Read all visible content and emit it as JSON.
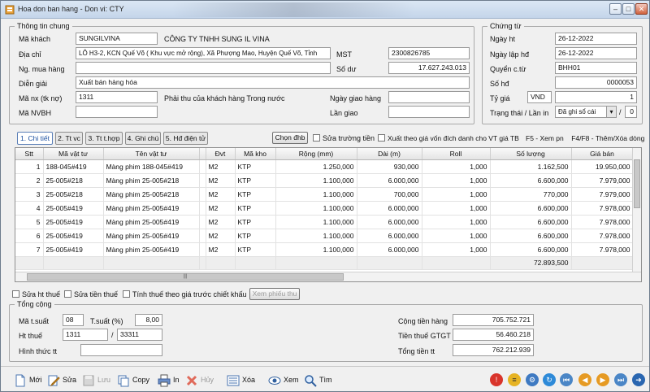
{
  "window": {
    "title": "Hoa don ban hang - Don vi: CTY"
  },
  "general": {
    "legend": "Thông tin chung",
    "customer_code_label": "Mã khách",
    "customer_code": "SUNGILVINA",
    "customer_name": "CÔNG TY TNHH SUNG IL VINA",
    "address_label": "Địa chỉ",
    "address": "LÔ H3-2, KCN Quế Võ ( Khu vực mở rộng), Xã Phượng Mao, Huyện Quế Võ, Tỉnh",
    "tax_code_label": "MST",
    "tax_code": "2300826785",
    "buyer_label": "Ng. mua hàng",
    "buyer": "",
    "balance_label": "Số dư",
    "balance": "17.627.243.013",
    "description_label": "Diễn giải",
    "description": "Xuất bán hàng hóa",
    "account_label": "Mã nx (tk nợ)",
    "account": "1311",
    "account_desc": "Phải thu của khách hàng Trong nước",
    "delivery_date_label": "Ngày giao hàng",
    "delivery_date": "",
    "staff_label": "Mã NVBH",
    "staff": "",
    "delivery_times_label": "Lần giao",
    "delivery_times": ""
  },
  "voucher": {
    "legend": "Chứng từ",
    "date_label": "Ngày ht",
    "date": "26-12-2022",
    "invoice_date_label": "Ngày lập hđ",
    "invoice_date": "26-12-2022",
    "book_label": "Quyển c.từ",
    "book": "BHH01",
    "invoice_no_label": "Số hđ",
    "invoice_no": "0000053",
    "rate_label": "Tỷ giá",
    "currency": "VND",
    "rate": "1",
    "status_label": "Trạng thái / Lần in",
    "status": "Đã ghi sổ cái",
    "print_count": "0"
  },
  "tabs": [
    "1. Chi tiết",
    "2. Tt vc",
    "3. Tt t.hợp",
    "4. Ghi chú",
    "5. Hđ điện tử"
  ],
  "detail_bar": {
    "choose_button": "Chọn đhb",
    "edit_amount_label": "Sửa trường tiền",
    "export_label": "Xuất theo giá vốn đích danh cho VT giá TB",
    "hint": "F5 - Xem pn    F4/F8 - Thêm/Xóa dòng"
  },
  "grid": {
    "columns": [
      "Stt",
      "Mã vật tư",
      "Tên vật tư",
      "",
      "Đvt",
      "Mã kho",
      "Rộng (mm)",
      "Dài (m)",
      "Roll",
      "Số lượng",
      "Giá bán"
    ],
    "rows": [
      [
        "1",
        "188-045#419",
        "Màng phim 188-045#419",
        "",
        "M2",
        "KTP",
        "1.250,000",
        "930,000",
        "1,000",
        "1.162,500",
        "19.950,000"
      ],
      [
        "2",
        "25-005#218",
        "Màng phim 25-005#218",
        "",
        "M2",
        "KTP",
        "1.100,000",
        "6.000,000",
        "1,000",
        "6.600,000",
        "7.979,000"
      ],
      [
        "3",
        "25-005#218",
        "Màng phim 25-005#218",
        "",
        "M2",
        "KTP",
        "1.100,000",
        "700,000",
        "1,000",
        "770,000",
        "7.979,000"
      ],
      [
        "4",
        "25-005#419",
        "Màng phim 25-005#419",
        "",
        "M2",
        "KTP",
        "1.100,000",
        "6.000,000",
        "1,000",
        "6.600,000",
        "7.978,000"
      ],
      [
        "5",
        "25-005#419",
        "Màng phim 25-005#419",
        "",
        "M2",
        "KTP",
        "1.100,000",
        "6.000,000",
        "1,000",
        "6.600,000",
        "7.978,000"
      ],
      [
        "6",
        "25-005#419",
        "Màng phim 25-005#419",
        "",
        "M2",
        "KTP",
        "1.100,000",
        "6.000,000",
        "1,000",
        "6.600,000",
        "7.978,000"
      ],
      [
        "7",
        "25-005#419",
        "Màng phim 25-005#419",
        "",
        "M2",
        "KTP",
        "1.100,000",
        "6.000,000",
        "1,000",
        "6.600,000",
        "7.978,000"
      ]
    ],
    "total_quantity": "72.893,500"
  },
  "tax_options": {
    "edit_tax": "Sửa ht thuế",
    "edit_tax_amount": "Sửa tiền thuế",
    "tax_before_discount": "Tính thuế theo giá trước chiết khấu",
    "view_receipt": "Xem phiếu thu"
  },
  "totals": {
    "legend": "Tổng cộng",
    "tax_code_label": "Mã t.suất",
    "tax_code": "08",
    "tax_rate_label": "T.suất (%)",
    "tax_rate": "8,00",
    "tax_account_label": "Ht thuế",
    "tax_account_debit": "1311",
    "tax_account_credit": "33311",
    "payment_label": "Hình thức tt",
    "payment": "",
    "goods_total_label": "Cộng tiền hàng",
    "goods_total": "705.752.721",
    "vat_label": "Tiền thuế GTGT",
    "vat": "56.460.218",
    "grand_total_label": "Tổng tiền tt",
    "grand_total": "762.212.939"
  },
  "toolbar": {
    "new": "Mới",
    "edit": "Sửa",
    "save": "Lưu",
    "copy": "Copy",
    "print": "In",
    "cancel": "Hủy",
    "delete": "Xóa",
    "view": "Xem",
    "find": "Tìm"
  }
}
